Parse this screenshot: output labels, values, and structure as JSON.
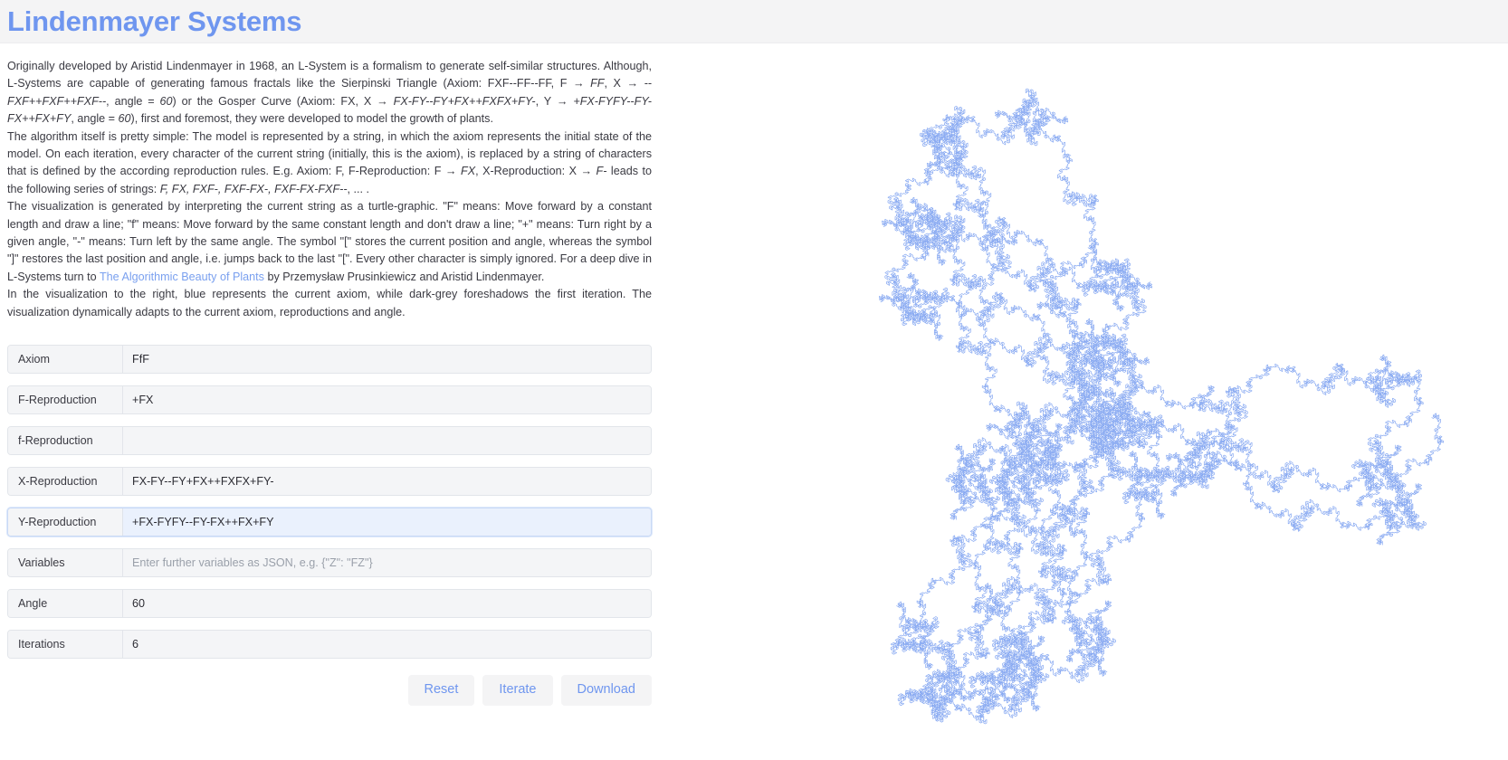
{
  "header": {
    "title": "Lindenmayer Systems"
  },
  "description": {
    "para1_a": "Originally developed by Aristid Lindenmayer in 1968, an L-System is a formalism to generate self-similar structures. Although, L-Systems are capable of generating famous fractals like the Sierpinski Triangle (Axiom: FXF--FF--FF, F → ",
    "para1_i1": "FF",
    "para1_b": ", X → ",
    "para1_i2": "--FXF++FXF++FXF--",
    "para1_c": ", angle = ",
    "para1_i3": "60",
    "para1_d": ") or the Gosper Curve (Axiom: FX, X → ",
    "para1_i4": "FX-FY--FY+FX++FXFX+FY-",
    "para1_e": ", Y → ",
    "para1_i5": "+FX-FYFY--FY-FX++FX+FY",
    "para1_f": ", angle = ",
    "para1_i6": "60",
    "para1_g": "), first and foremost, they were developed to model the growth of plants.",
    "para2_a": "The algorithm itself is pretty simple: The model is represented by a string, in which the axiom represents the initial state of the model. On each iteration, every character of the current string (initially, this is the axiom), is replaced by a string of characters that is defined by the according reproduction rules. E.g. Axiom: F, F-Reproduction: F → ",
    "para2_i1": "FX",
    "para2_b": ", X-Reproduction: X → ",
    "para2_i2": "F-",
    "para2_c": " leads to the following series of strings: ",
    "para2_i3": "F, FX, FXF-, FXF-FX-, FXF-FX-FXF--",
    "para2_d": ", ... .",
    "para3_a": "The visualization is generated by interpreting the current string as a turtle-graphic. \"F\" means: Move forward by a constant length and draw a line; \"f\" means: Move forward by the same constant length and don't draw a line; \"+\" means: Turn right by a given angle, \"-\" means: Turn left by the same angle. The symbol \"[\" stores the current position and angle, whereas the symbol \"]\" restores the last position and angle, i.e. jumps back to the last \"[\". Every other character is simply ignored. For a deep dive in L-Systems turn to ",
    "para3_link": "The Algorithmic Beauty of Plants",
    "para3_b": " by Przemysław Prusinkiewicz and Aristid Lindenmayer.",
    "para4": "In the visualization to the right, blue represents the current axiom, while dark-grey foreshadows the first iteration. The visualization dynamically adapts to the current axiom, reproductions and angle."
  },
  "form": {
    "fields": [
      {
        "label": "Axiom",
        "value": "FfF",
        "placeholder": "",
        "focused": false
      },
      {
        "label": "F-Reproduction",
        "value": "+FX",
        "placeholder": "",
        "focused": false
      },
      {
        "label": "f-Reproduction",
        "value": "",
        "placeholder": "",
        "focused": false
      },
      {
        "label": "X-Reproduction",
        "value": "FX-FY--FY+FX++FXFX+FY-",
        "placeholder": "",
        "focused": false
      },
      {
        "label": "Y-Reproduction",
        "value": "+FX-FYFY--FY-FX++FX+FY",
        "placeholder": "",
        "focused": true
      },
      {
        "label": "Variables",
        "value": "",
        "placeholder": "Enter further variables as JSON, e.g. {\"Z\": \"FZ\"}",
        "focused": false
      },
      {
        "label": "Angle",
        "value": "60",
        "placeholder": "",
        "focused": false
      },
      {
        "label": "Iterations",
        "value": "6",
        "placeholder": "",
        "focused": false
      }
    ],
    "buttons": [
      {
        "label": "Reset",
        "name": "reset-button"
      },
      {
        "label": "Iterate",
        "name": "iterate-button"
      },
      {
        "label": "Download",
        "name": "download-button"
      }
    ]
  },
  "visualization": {
    "axiom_color": "#6f96ef",
    "next_iteration_color": "#555a63",
    "rendered_axiom": "FfF",
    "rendered_angle": "60",
    "rendered_iterations": "6"
  }
}
